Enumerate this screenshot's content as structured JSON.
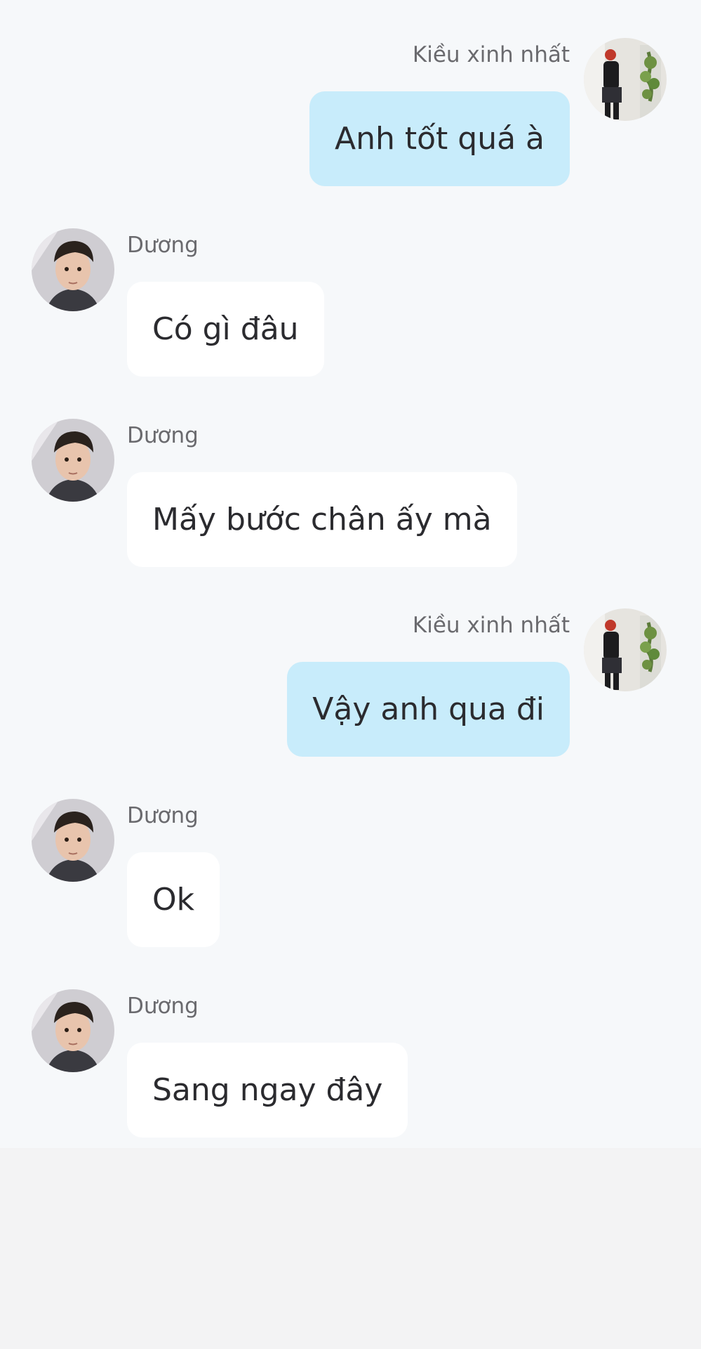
{
  "colors": {
    "chat_background": "#f6f8fa",
    "page_background": "#f3f3f4",
    "sent_bubble": "#c8ecfb",
    "received_bubble": "#ffffff",
    "sender_name": "#6a6a6e",
    "message_text": "#2b2b2f"
  },
  "messages": [
    {
      "direction": "sent",
      "sender": "Kiều xinh nhất",
      "text": "Anh tốt quá à",
      "avatar": "avatar-kieu"
    },
    {
      "direction": "received",
      "sender": "Dương",
      "text": "Có gì đâu",
      "avatar": "avatar-duong"
    },
    {
      "direction": "received",
      "sender": "Dương",
      "text": "Mấy bước chân ấy mà",
      "avatar": "avatar-duong"
    },
    {
      "direction": "sent",
      "sender": "Kiều xinh nhất",
      "text": "Vậy anh qua đi",
      "avatar": "avatar-kieu"
    },
    {
      "direction": "received",
      "sender": "Dương",
      "text": "Ok",
      "avatar": "avatar-duong"
    },
    {
      "direction": "received",
      "sender": "Dương",
      "text": "Sang ngay đây",
      "avatar": "avatar-duong"
    }
  ]
}
